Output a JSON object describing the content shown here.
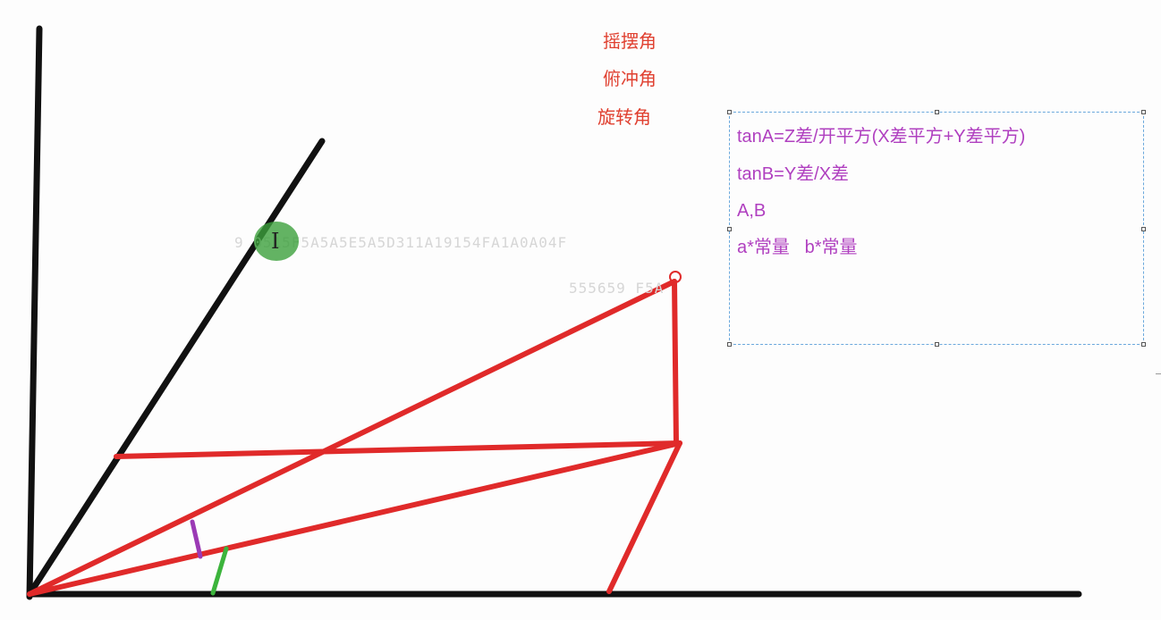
{
  "angle_labels": {
    "yaw": "摇摆角",
    "pitch": "俯冲角",
    "roll": "旋转角"
  },
  "background_text": {
    "line1": "9  0515F5A5A5E5A5D311A19154FA1A0A04F",
    "line2": "555659  F5A"
  },
  "formula_box": {
    "line1": "tanA=Z差/开平方(X差平方+Y差平方)",
    "line2": "tanB=Y差/X差",
    "line3": "A,B",
    "line4": "a*常量   b*常量"
  },
  "cursor": {
    "glyph": "I",
    "highlight_color": "#3ca03c"
  },
  "colors": {
    "axis": "#111111",
    "projection": "#e02a2a",
    "angle_mark_a": "#9b3ab5",
    "angle_mark_b": "#3cb43c",
    "label_red": "#e04030",
    "formula_purple": "#b040c0"
  }
}
